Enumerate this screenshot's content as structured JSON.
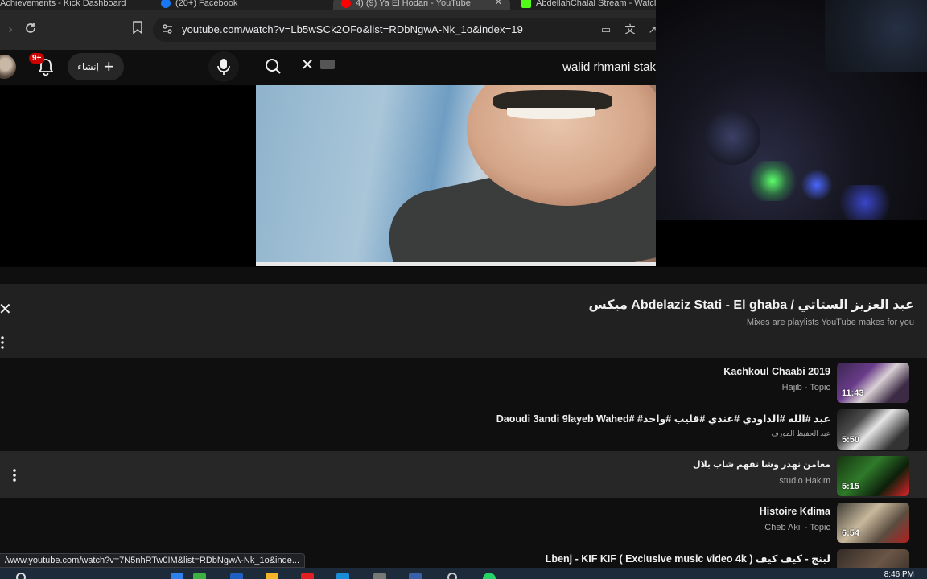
{
  "browser": {
    "tabs": [
      {
        "label": "Achievements - Kick Dashboard",
        "active": false
      },
      {
        "label": "(20+) Facebook",
        "active": false
      },
      {
        "label": "4) (9) Ya El Hodari - YouTube",
        "active": true
      },
      {
        "label": "AbdellahChalal Stream - Watch",
        "active": false
      }
    ],
    "url": "youtube.com/watch?v=Lb5wSCk2OFo&list=RDbNgwA-Nk_1o&index=19",
    "status_link": "/www.youtube.com/watch?v=7N5nhRTw0IM&list=RDbNgwA-Nk_1o&inde..."
  },
  "masthead": {
    "notification_count": "9+",
    "create_label": "إنشاء",
    "search_value": "walid rhmani stak"
  },
  "playlist": {
    "title": "ميكس Abdelaziz Stati - El ghaba / عبد العزيز الستاتي",
    "subtitle": "Mixes are playlists YouTube makes for you",
    "items": [
      {
        "title": "Kachkoul Chaabi 2019",
        "channel": "Hajib - Topic",
        "duration": "11:43"
      },
      {
        "title": "Daoudi 3andi 9layeb Wahed# #عبد #الله #الداودي #عندي #قليب #واحد",
        "channel": "عبد الحفيظ المورف",
        "duration": "5:50"
      },
      {
        "title": "معامن نهدر وشا نفهم شاب بلال",
        "channel": "studio Hakim",
        "duration": "5:15"
      },
      {
        "title": "Histoire Kdima",
        "channel": "Cheb Akil - Topic",
        "duration": "6:54"
      },
      {
        "title": "Lbenj - KIF KIF ( Exclusive music video 4k ) لبنج - كيف كيف",
        "channel": "",
        "duration": ""
      }
    ]
  },
  "taskbar": {
    "time": "8:46 PM"
  },
  "colors": {
    "background": "#0f0f0f",
    "panel": "#212121",
    "hover_row": "#272727",
    "badge": "#cc0000"
  }
}
